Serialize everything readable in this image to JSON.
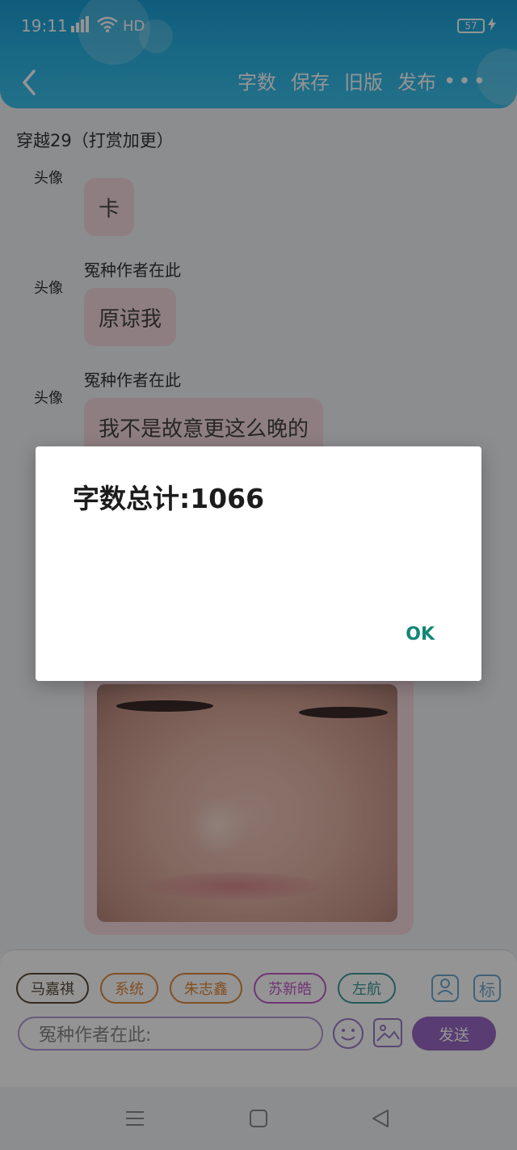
{
  "status_bar": {
    "time": "19:11",
    "network": "4G",
    "hd": "HD",
    "battery": "57"
  },
  "header": {
    "actions": [
      "字数",
      "保存",
      "旧版",
      "发布"
    ],
    "more": "•••"
  },
  "chat_title": "穿越29（打赏加更）",
  "messages": [
    {
      "avatar": "头像",
      "sender": "",
      "text": "卡"
    },
    {
      "avatar": "头像",
      "sender": "冤种作者在此",
      "text": "原谅我"
    },
    {
      "avatar": "头像",
      "sender": "冤种作者在此",
      "text": "我不是故意更这么晚的"
    }
  ],
  "bottom": {
    "roles": [
      {
        "label": "马嘉祺",
        "color": "#5a4a3a"
      },
      {
        "label": "系统",
        "color": "#e0893a"
      },
      {
        "label": "朱志鑫",
        "color": "#e0893a"
      },
      {
        "label": "苏新皓",
        "color": "#c25bc9"
      },
      {
        "label": "左航",
        "color": "#3f9a9a"
      }
    ],
    "mark_label": "标",
    "input_value": "冤种作者在此:",
    "send_label": "发送"
  },
  "dialog": {
    "message": "字数总计:1066",
    "ok_label": "OK"
  }
}
